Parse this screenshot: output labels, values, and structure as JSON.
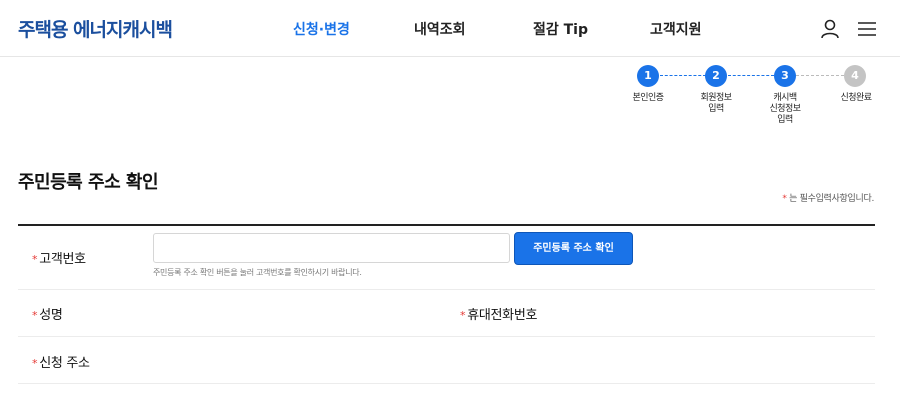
{
  "header": {
    "logo": "주택용 에너지캐시백",
    "nav": [
      "신청·변경",
      "내역조회",
      "절감 Tip",
      "고객지원"
    ],
    "active_nav": "신청·변경",
    "icons": [
      "user-icon",
      "menu-icon"
    ]
  },
  "stepper": {
    "steps": [
      {
        "number": "1",
        "label": "본인인증",
        "status": "done"
      },
      {
        "number": "2",
        "label": "회원정보\n입력",
        "status": "done"
      },
      {
        "number": "3",
        "label": "캐시백\n신청정보\n입력",
        "status": "current"
      },
      {
        "number": "4",
        "label": "신청완료",
        "status": "todo"
      }
    ]
  },
  "page": {
    "title": "주민등록 주소 확인",
    "required_star": "*",
    "required_note": " 는 필수입력사항입니다."
  },
  "form": {
    "customer_number": {
      "star": "*",
      "label": "고객번호",
      "value": "",
      "button": "주민등록 주소 확인",
      "helper": "주민등록 주소 확인 버튼을 눌러 고객번호를 확인하시기 바랍니다."
    },
    "name": {
      "star": "*",
      "label": "성명",
      "value": ""
    },
    "phone": {
      "star": "*",
      "label": "휴대전화번호",
      "value": ""
    },
    "address": {
      "star": "*",
      "label": "신청 주소",
      "value": ""
    }
  },
  "colors": {
    "accent": "#1a73e8",
    "logo": "#1b4f9e",
    "required": "#e53935",
    "step_inactive": "#c4c4c4"
  }
}
